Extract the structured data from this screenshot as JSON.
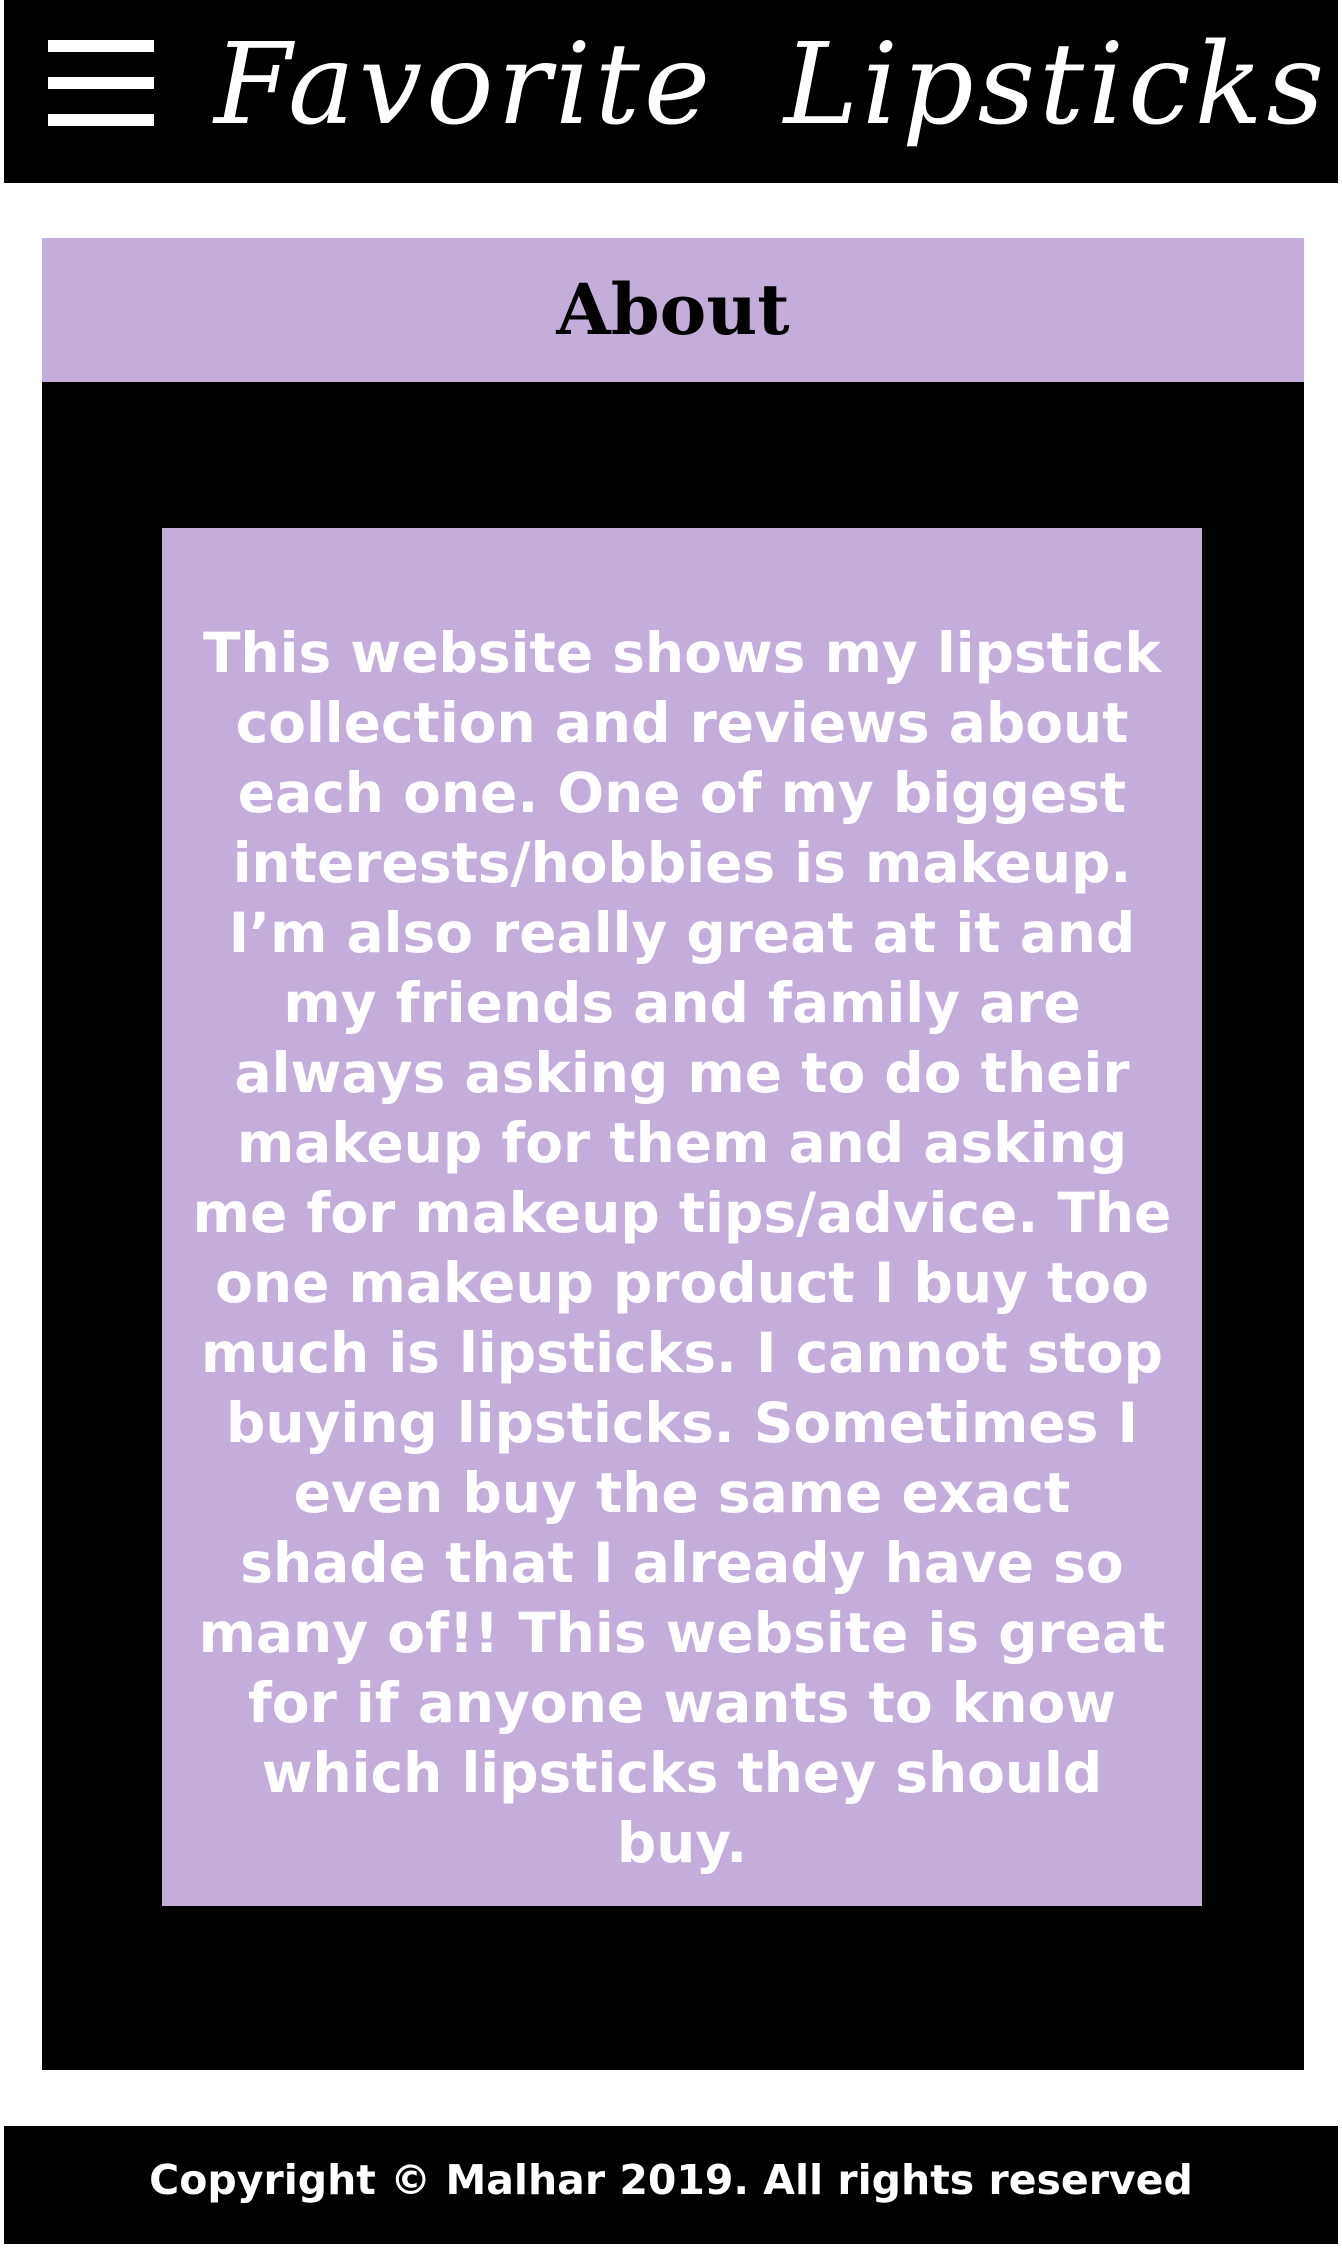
{
  "header": {
    "title": "Favorite Lipsticks",
    "menu_icon": "hamburger-menu-icon"
  },
  "about": {
    "heading": "About",
    "body": "This website shows my lipstick collection and reviews about each one. One of my biggest interests/hobbies is makeup. I’m also really great at it and my friends and family are always asking me to do their makeup for them and asking me for makeup tips/advice. The one makeup product I buy too much is lipsticks. I cannot stop buying lipsticks. Sometimes I even buy the same exact shade that I already have so many of!! This website is great for if anyone wants to know which lipsticks they should buy."
  },
  "footer": {
    "copyright": "Copyright © Malhar 2019. All rights reserved"
  },
  "colors": {
    "header_bg": "#000000",
    "accent_lavender": "#c4acdb",
    "text_light": "#ffffff",
    "page_bg": "#ffffff"
  }
}
